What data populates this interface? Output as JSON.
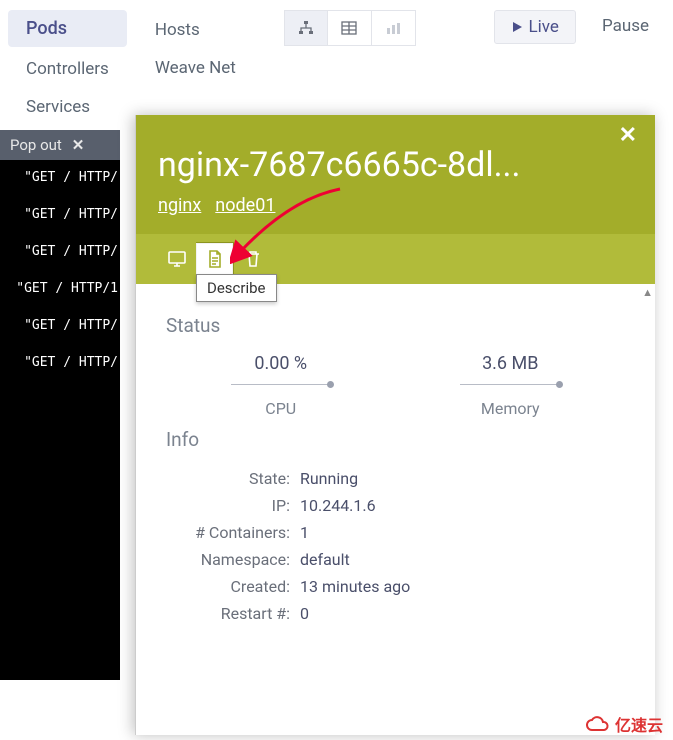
{
  "nav": {
    "col1": [
      {
        "label": "Pods",
        "active": true
      },
      {
        "label": "Controllers",
        "active": false
      },
      {
        "label": "Services",
        "active": false
      }
    ],
    "col2": [
      {
        "label": "Hosts"
      },
      {
        "label": "Weave Net"
      }
    ]
  },
  "toolbar_icons": [
    "sitemap-icon",
    "table-icon",
    "barchart-icon"
  ],
  "live_label": "Live",
  "pause_label": "Pause",
  "metric_tabs": {
    "cpu": "CPU",
    "memory": "Memory"
  },
  "popout_label": "Pop out",
  "terminal_lines": [
    "\"GET / HTTP/",
    "\"GET / HTTP/",
    "\"GET / HTTP/",
    "\"GET / HTTP/1",
    "\"GET / HTTP/",
    "\"GET / HTTP/"
  ],
  "detail": {
    "title": "nginx-7687c6665c-8dl...",
    "links": [
      "nginx",
      "node01"
    ],
    "tooltip": "Describe",
    "status_label": "Status",
    "cpu_val": "0.00 %",
    "cpu_lbl": "CPU",
    "mem_val": "3.6 MB",
    "mem_lbl": "Memory",
    "info_label": "Info",
    "info": {
      "state_k": "State:",
      "state_v": "Running",
      "ip_k": "IP:",
      "ip_v": "10.244.1.6",
      "cont_k": "# Containers:",
      "cont_v": "1",
      "ns_k": "Namespace:",
      "ns_v": "default",
      "created_k": "Created:",
      "created_v": "13 minutes ago",
      "restart_k": "Restart #:",
      "restart_v": "0"
    }
  },
  "brand": "亿速云"
}
